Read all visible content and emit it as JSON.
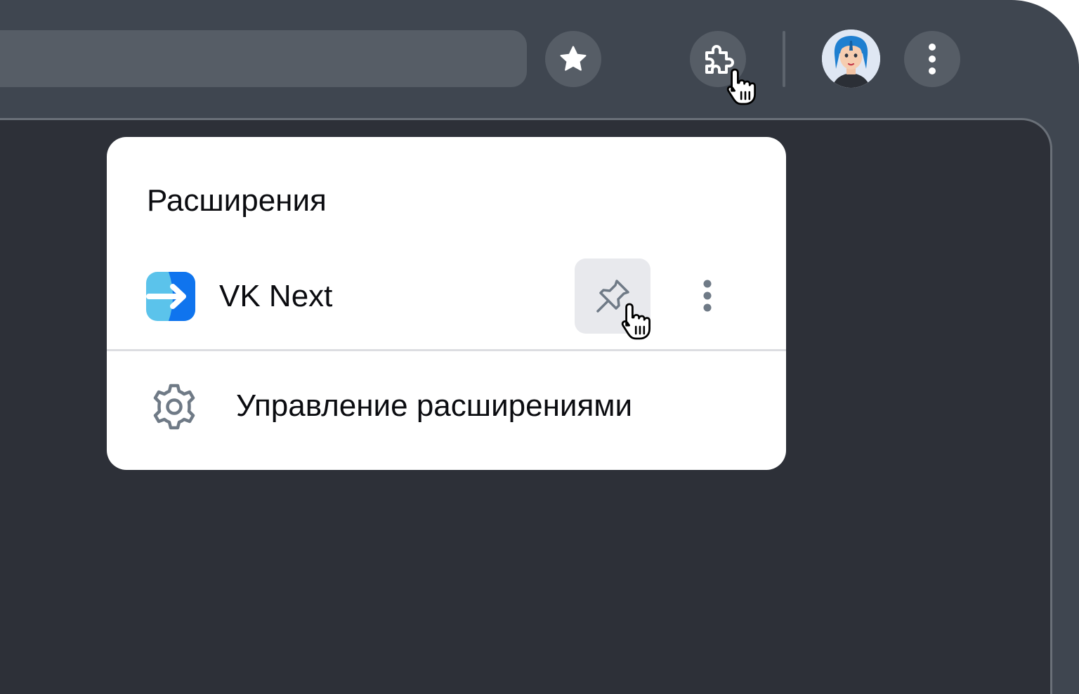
{
  "extensions_popup": {
    "title": "Расширения",
    "extensions": [
      {
        "name": "VK Next",
        "icon": "vk-next-logo",
        "pinned": false
      }
    ],
    "manage_label": "Управление расширениями"
  },
  "toolbar": {
    "bookmark_icon": "star-icon",
    "extensions_icon": "puzzle-icon",
    "menu_icon": "more-vertical-icon",
    "avatar": "profile-avatar"
  },
  "colors": {
    "frame": "#3f4650",
    "toolbar_button": "#565d66",
    "page_background": "#2d3038",
    "popup_background": "#ffffff",
    "vk_next_accent": "#0f74ee",
    "vk_next_light": "#5bc3eb"
  }
}
